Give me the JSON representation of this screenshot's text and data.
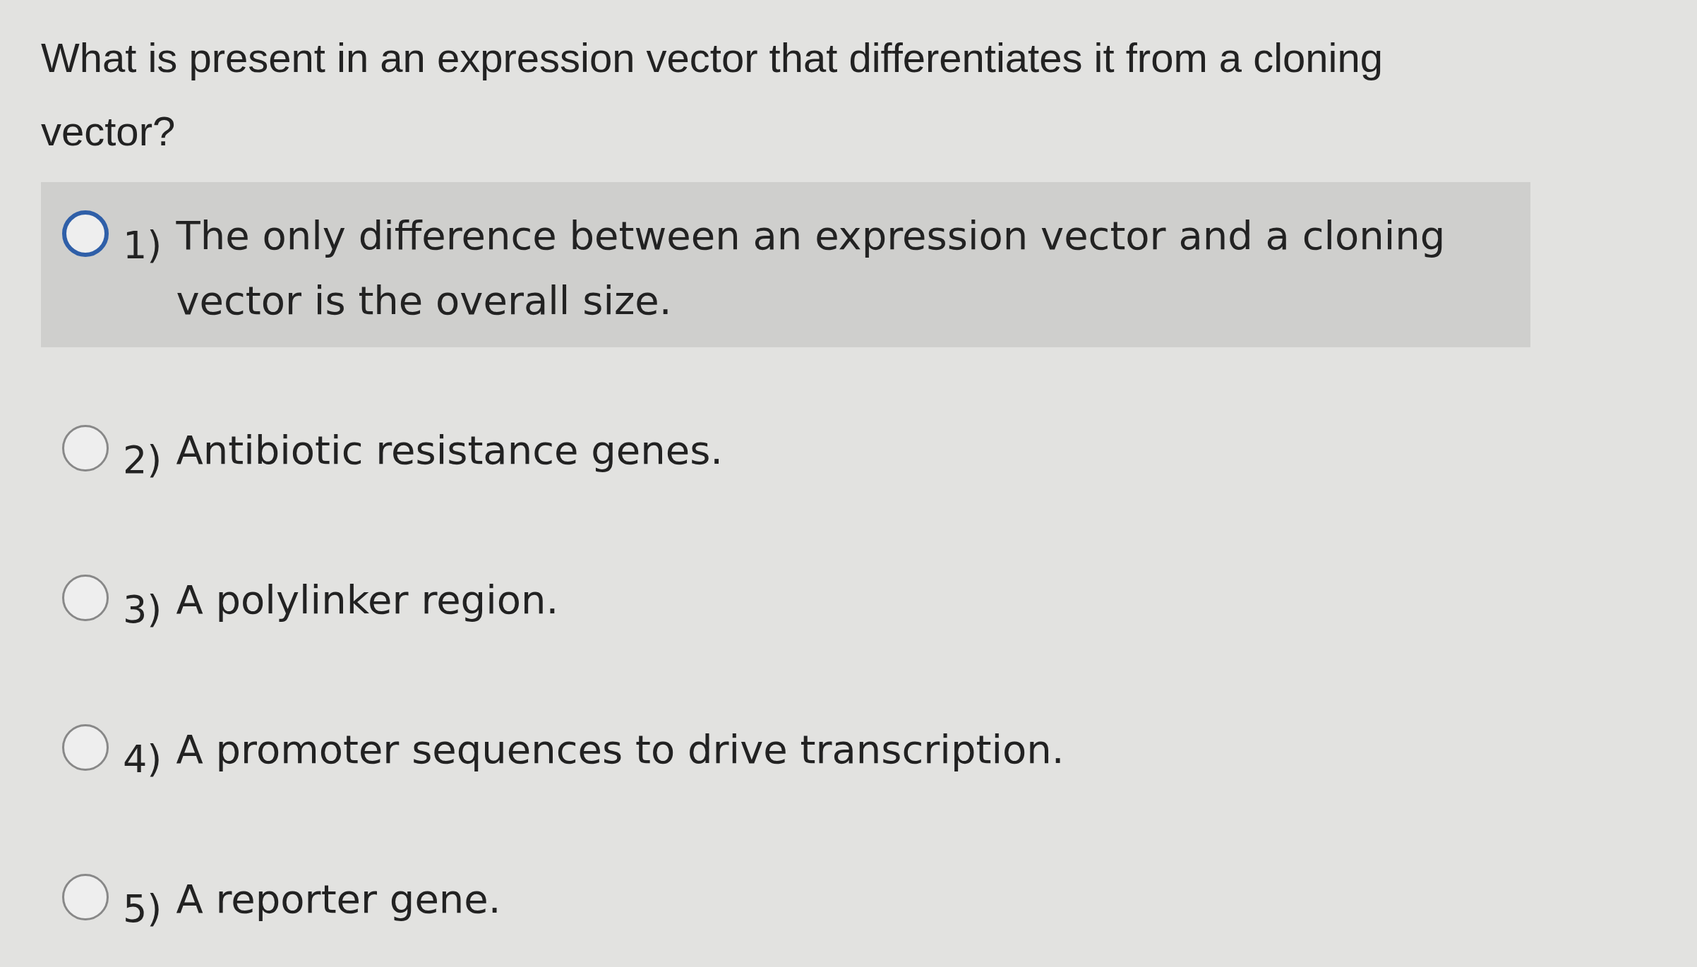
{
  "question": "What is present in an expression vector that differentiates it from a cloning vector?",
  "options": [
    {
      "number": "1)",
      "label": "The only difference between an expression vector and a cloning vector is the overall size.",
      "selected": false,
      "hovered": true
    },
    {
      "number": "2)",
      "label": "Antibiotic resistance genes.",
      "selected": false,
      "hovered": false
    },
    {
      "number": "3)",
      "label": "A polylinker region.",
      "selected": false,
      "hovered": false
    },
    {
      "number": "4)",
      "label": "A promoter sequences to drive transcription.",
      "selected": false,
      "hovered": false
    },
    {
      "number": "5)",
      "label": "A reporter gene.",
      "selected": false,
      "hovered": false
    }
  ]
}
